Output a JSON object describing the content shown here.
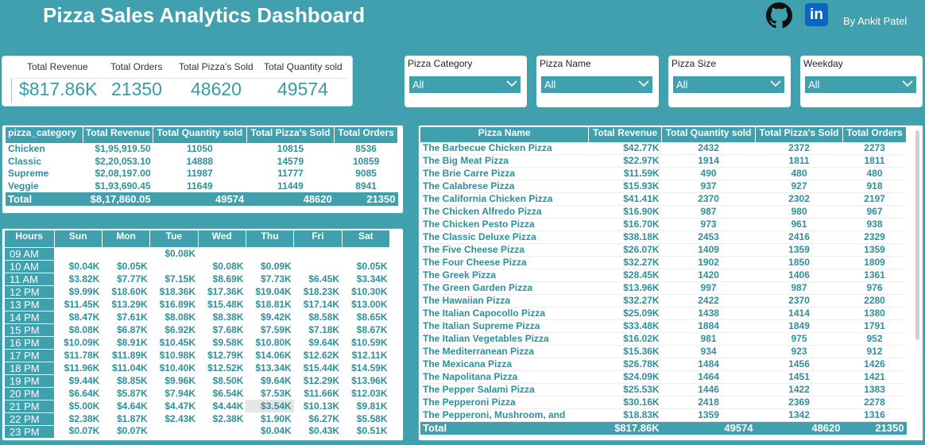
{
  "header": {
    "title": "Pizza Sales Analytics Dashboard",
    "linkedin_glyph": "in",
    "author": "By Ankit Patel",
    "icons": [
      "github-icon",
      "linkedin-icon"
    ]
  },
  "kpis": [
    {
      "label": "Total Revenue",
      "value": "$817.86K"
    },
    {
      "label": "Total Orders",
      "value": "21350"
    },
    {
      "label": "Total Pizza's Sold",
      "value": "48620"
    },
    {
      "label": "Total Quantity sold",
      "value": "49574"
    }
  ],
  "slicers": [
    {
      "label": "Pizza Category",
      "value": "All"
    },
    {
      "label": "Pizza Name",
      "value": "All"
    },
    {
      "label": "Pizza Size",
      "value": "All"
    },
    {
      "label": "Weekday",
      "value": "All"
    }
  ],
  "category_table": {
    "headers": [
      "pizza_category",
      "Total Revenue",
      "Total Quantity sold",
      "Total Pizza's Sold",
      "Total Orders"
    ],
    "rows": [
      [
        "Chicken",
        "$1,95,919.50",
        "11050",
        "10815",
        "8536"
      ],
      [
        "Classic",
        "$2,20,053.10",
        "14888",
        "14579",
        "10859"
      ],
      [
        "Supreme",
        "$2,08,197.00",
        "11987",
        "11777",
        "9085"
      ],
      [
        "Veggie",
        "$1,93,690.45",
        "11649",
        "11449",
        "8941"
      ]
    ],
    "total": [
      "Total",
      "$8,17,860.05",
      "49574",
      "48620",
      "21350"
    ]
  },
  "hour_table": {
    "headers": [
      "Hours",
      "Sun",
      "Mon",
      "Tue",
      "Wed",
      "Thu",
      "Fri",
      "Sat"
    ],
    "rows": [
      [
        "09 AM",
        "",
        "",
        "$0.08K",
        "",
        "",
        "",
        ""
      ],
      [
        "10 AM",
        "$0.04K",
        "$0.05K",
        "",
        "$0.08K",
        "$0.09K",
        "",
        "$0.05K"
      ],
      [
        "11 AM",
        "$3.82K",
        "$7.77K",
        "$7.15K",
        "$8.69K",
        "$7.73K",
        "$6.45K",
        "$3.34K"
      ],
      [
        "12 PM",
        "$9.99K",
        "$18.60K",
        "$18.36K",
        "$17.36K",
        "$19.04K",
        "$18.23K",
        "$10.30K"
      ],
      [
        "13 PM",
        "$11.45K",
        "$13.29K",
        "$16.89K",
        "$15.48K",
        "$18.81K",
        "$17.14K",
        "$13.00K"
      ],
      [
        "14 PM",
        "$8.47K",
        "$7.61K",
        "$8.08K",
        "$8.38K",
        "$9.42K",
        "$8.58K",
        "$8.65K"
      ],
      [
        "15 PM",
        "$8.08K",
        "$6.87K",
        "$6.92K",
        "$7.68K",
        "$7.59K",
        "$7.18K",
        "$8.67K"
      ],
      [
        "16 PM",
        "$10.09K",
        "$8.91K",
        "$10.45K",
        "$9.58K",
        "$10.80K",
        "$9.64K",
        "$10.59K"
      ],
      [
        "17 PM",
        "$11.78K",
        "$11.89K",
        "$10.98K",
        "$12.79K",
        "$14.06K",
        "$12.62K",
        "$12.11K"
      ],
      [
        "18 PM",
        "$11.96K",
        "$11.04K",
        "$10.40K",
        "$12.52K",
        "$13.34K",
        "$15.44K",
        "$14.59K"
      ],
      [
        "19 PM",
        "$9.44K",
        "$8.85K",
        "$9.96K",
        "$8.50K",
        "$9.64K",
        "$12.29K",
        "$13.96K"
      ],
      [
        "20 PM",
        "$6.64K",
        "$5.87K",
        "$7.94K",
        "$6.54K",
        "$7.53K",
        "$11.66K",
        "$12.03K"
      ],
      [
        "21 PM",
        "$5.00K",
        "$4.64K",
        "$4.47K",
        "$4.44K",
        "$3.54K",
        "$10.13K",
        "$9.81K"
      ],
      [
        "22 PM",
        "$2.38K",
        "$1.87K",
        "$2.43K",
        "$2.38K",
        "$1.90K",
        "$6.27K",
        "$5.58K"
      ],
      [
        "23 PM",
        "$0.07K",
        "$0.07K",
        "",
        "",
        "$0.04K",
        "$0.43K",
        "$0.51K"
      ]
    ],
    "highlight": {
      "hour": "21 PM",
      "day": "Thu"
    }
  },
  "pizza_table": {
    "headers": [
      "Pizza Name",
      "Total Revenue",
      "Total Quantity sold",
      "Total Pizza's Sold",
      "Total Orders"
    ],
    "rows": [
      [
        "The Barbecue Chicken Pizza",
        "$42.77K",
        "2432",
        "2372",
        "2273"
      ],
      [
        "The Big Meat Pizza",
        "$22.97K",
        "1914",
        "1811",
        "1811"
      ],
      [
        "The Brie Carre Pizza",
        "$11.59K",
        "490",
        "480",
        "480"
      ],
      [
        "The Calabrese Pizza",
        "$15.93K",
        "937",
        "927",
        "918"
      ],
      [
        "The California Chicken Pizza",
        "$41.41K",
        "2370",
        "2302",
        "2197"
      ],
      [
        "The Chicken Alfredo Pizza",
        "$16.90K",
        "987",
        "980",
        "967"
      ],
      [
        "The Chicken Pesto Pizza",
        "$16.70K",
        "973",
        "961",
        "938"
      ],
      [
        "The Classic Deluxe Pizza",
        "$38.18K",
        "2453",
        "2416",
        "2329"
      ],
      [
        "The Five Cheese Pizza",
        "$26.07K",
        "1409",
        "1359",
        "1359"
      ],
      [
        "The Four Cheese Pizza",
        "$32.27K",
        "1902",
        "1850",
        "1809"
      ],
      [
        "The Greek Pizza",
        "$28.45K",
        "1420",
        "1406",
        "1361"
      ],
      [
        "The Green Garden Pizza",
        "$13.96K",
        "997",
        "987",
        "976"
      ],
      [
        "The Hawaiian Pizza",
        "$32.27K",
        "2422",
        "2370",
        "2280"
      ],
      [
        "The Italian Capocollo Pizza",
        "$25.09K",
        "1438",
        "1414",
        "1380"
      ],
      [
        "The Italian Supreme Pizza",
        "$33.48K",
        "1884",
        "1849",
        "1791"
      ],
      [
        "The Italian Vegetables Pizza",
        "$16.02K",
        "981",
        "975",
        "952"
      ],
      [
        "The Mediterranean Pizza",
        "$15.36K",
        "934",
        "923",
        "912"
      ],
      [
        "The Mexicana Pizza",
        "$26.78K",
        "1484",
        "1456",
        "1426"
      ],
      [
        "The Napolitana Pizza",
        "$24.09K",
        "1464",
        "1451",
        "1421"
      ],
      [
        "The Pepper Salami Pizza",
        "$25.53K",
        "1446",
        "1422",
        "1383"
      ],
      [
        "The Pepperoni Pizza",
        "$30.16K",
        "2418",
        "2369",
        "2278"
      ],
      [
        "The Pepperoni, Mushroom, and",
        "$18.83K",
        "1359",
        "1342",
        "1316"
      ]
    ],
    "total": [
      "Total",
      "$817.86K",
      "49574",
      "48620",
      "21350"
    ]
  }
}
